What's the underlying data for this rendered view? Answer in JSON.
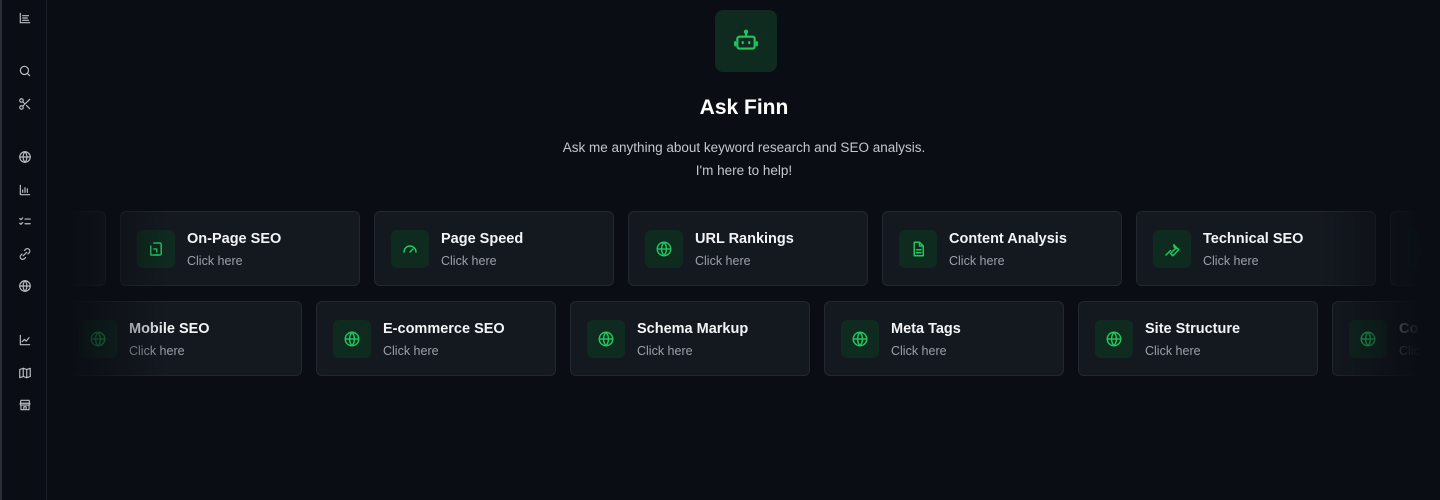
{
  "sidebar": {
    "items": [
      {
        "name": "list-icon"
      },
      {
        "name": "search-icon"
      },
      {
        "name": "scissors-icon"
      },
      {
        "name": "globe-icon"
      },
      {
        "name": "chart-icon"
      },
      {
        "name": "checklist-icon"
      },
      {
        "name": "link-icon"
      },
      {
        "name": "globe-icon"
      },
      {
        "name": "line-chart-icon"
      },
      {
        "name": "map-icon"
      },
      {
        "name": "store-icon"
      }
    ]
  },
  "hero": {
    "icon": "robot-icon",
    "title": "Ask Finn",
    "subtitle_line1": "Ask me anything about keyword research and SEO analysis.",
    "subtitle_line2": "I'm here to help!"
  },
  "row1": [
    {
      "title": "",
      "subtitle": "",
      "icon": "globe-icon"
    },
    {
      "title": "On-Page SEO",
      "subtitle": "Click here",
      "icon": "page-icon"
    },
    {
      "title": "Page Speed",
      "subtitle": "Click here",
      "icon": "gauge-icon"
    },
    {
      "title": "URL Rankings",
      "subtitle": "Click here",
      "icon": "globe-icon"
    },
    {
      "title": "Content Analysis",
      "subtitle": "Click here",
      "icon": "document-icon"
    },
    {
      "title": "Technical SEO",
      "subtitle": "Click here",
      "icon": "wrench-icon"
    },
    {
      "title": "",
      "subtitle": "",
      "icon": "globe-icon"
    }
  ],
  "row2": [
    {
      "title": "Mobile SEO",
      "subtitle": "Click here",
      "icon": "globe-icon"
    },
    {
      "title": "E-commerce SEO",
      "subtitle": "Click here",
      "icon": "globe-icon"
    },
    {
      "title": "Schema Markup",
      "subtitle": "Click here",
      "icon": "globe-icon"
    },
    {
      "title": "Meta Tags",
      "subtitle": "Click here",
      "icon": "globe-icon"
    },
    {
      "title": "Site Structure",
      "subtitle": "Click here",
      "icon": "globe-icon"
    },
    {
      "title": "Co",
      "subtitle": "Clic",
      "icon": "globe-icon"
    }
  ],
  "colors": {
    "background": "#0a0e14",
    "card": "#14181f",
    "accent": "#22c55e",
    "icon_bg": "#0f2a1f"
  }
}
